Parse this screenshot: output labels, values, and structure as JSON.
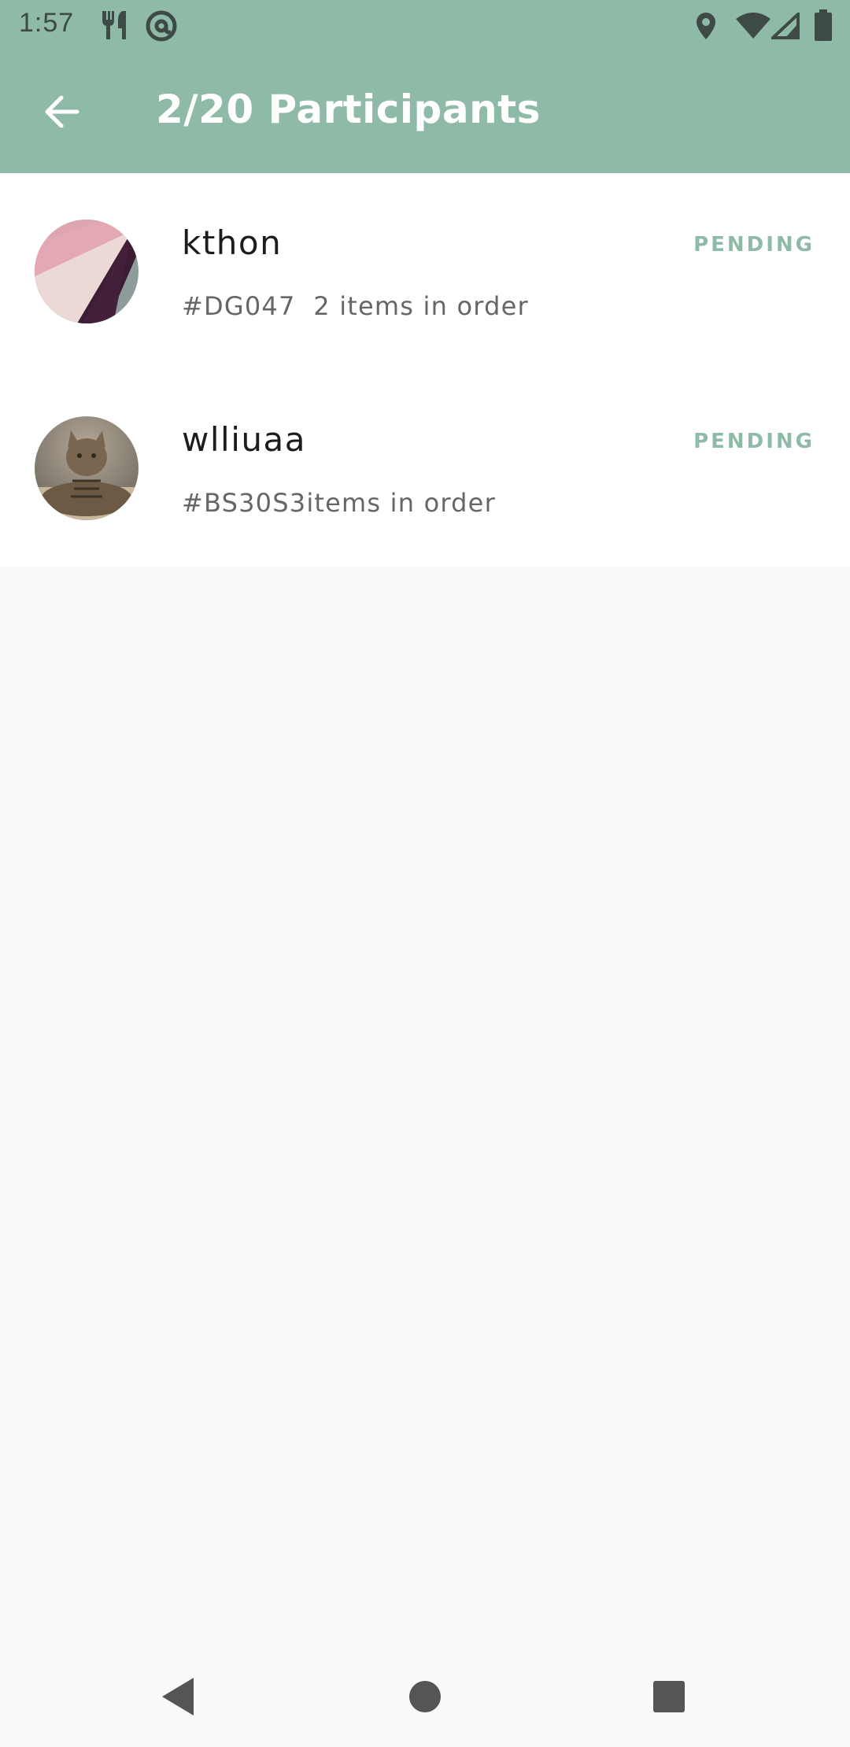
{
  "status_bar": {
    "time": "1:57",
    "left_icons": [
      "restaurant-icon",
      "at-sign-icon"
    ],
    "right_icons": [
      "location-pin-icon",
      "wifi-icon",
      "cell-signal-icon",
      "battery-icon"
    ]
  },
  "app_bar": {
    "title": "2/20 Participants",
    "back_icon": "arrow-left-icon"
  },
  "participants": [
    {
      "name": "kthon",
      "order_code": "#DG047",
      "items": "2 items in order",
      "status": "PENDING",
      "avatar": "abstract-pink-purple-avatar"
    },
    {
      "name": "wlliuaa",
      "order_code": "#BS30S3",
      "items": "items in order",
      "status": "PENDING",
      "avatar": "cat-photo-avatar"
    }
  ],
  "colors": {
    "primary": "#8fbaa8",
    "background": "#f9f9f9",
    "surface": "#ffffff",
    "status_text": "#8fbaa8"
  },
  "nav_bar": {
    "buttons": [
      "back-triangle-icon",
      "home-circle-icon",
      "recents-square-icon"
    ]
  }
}
